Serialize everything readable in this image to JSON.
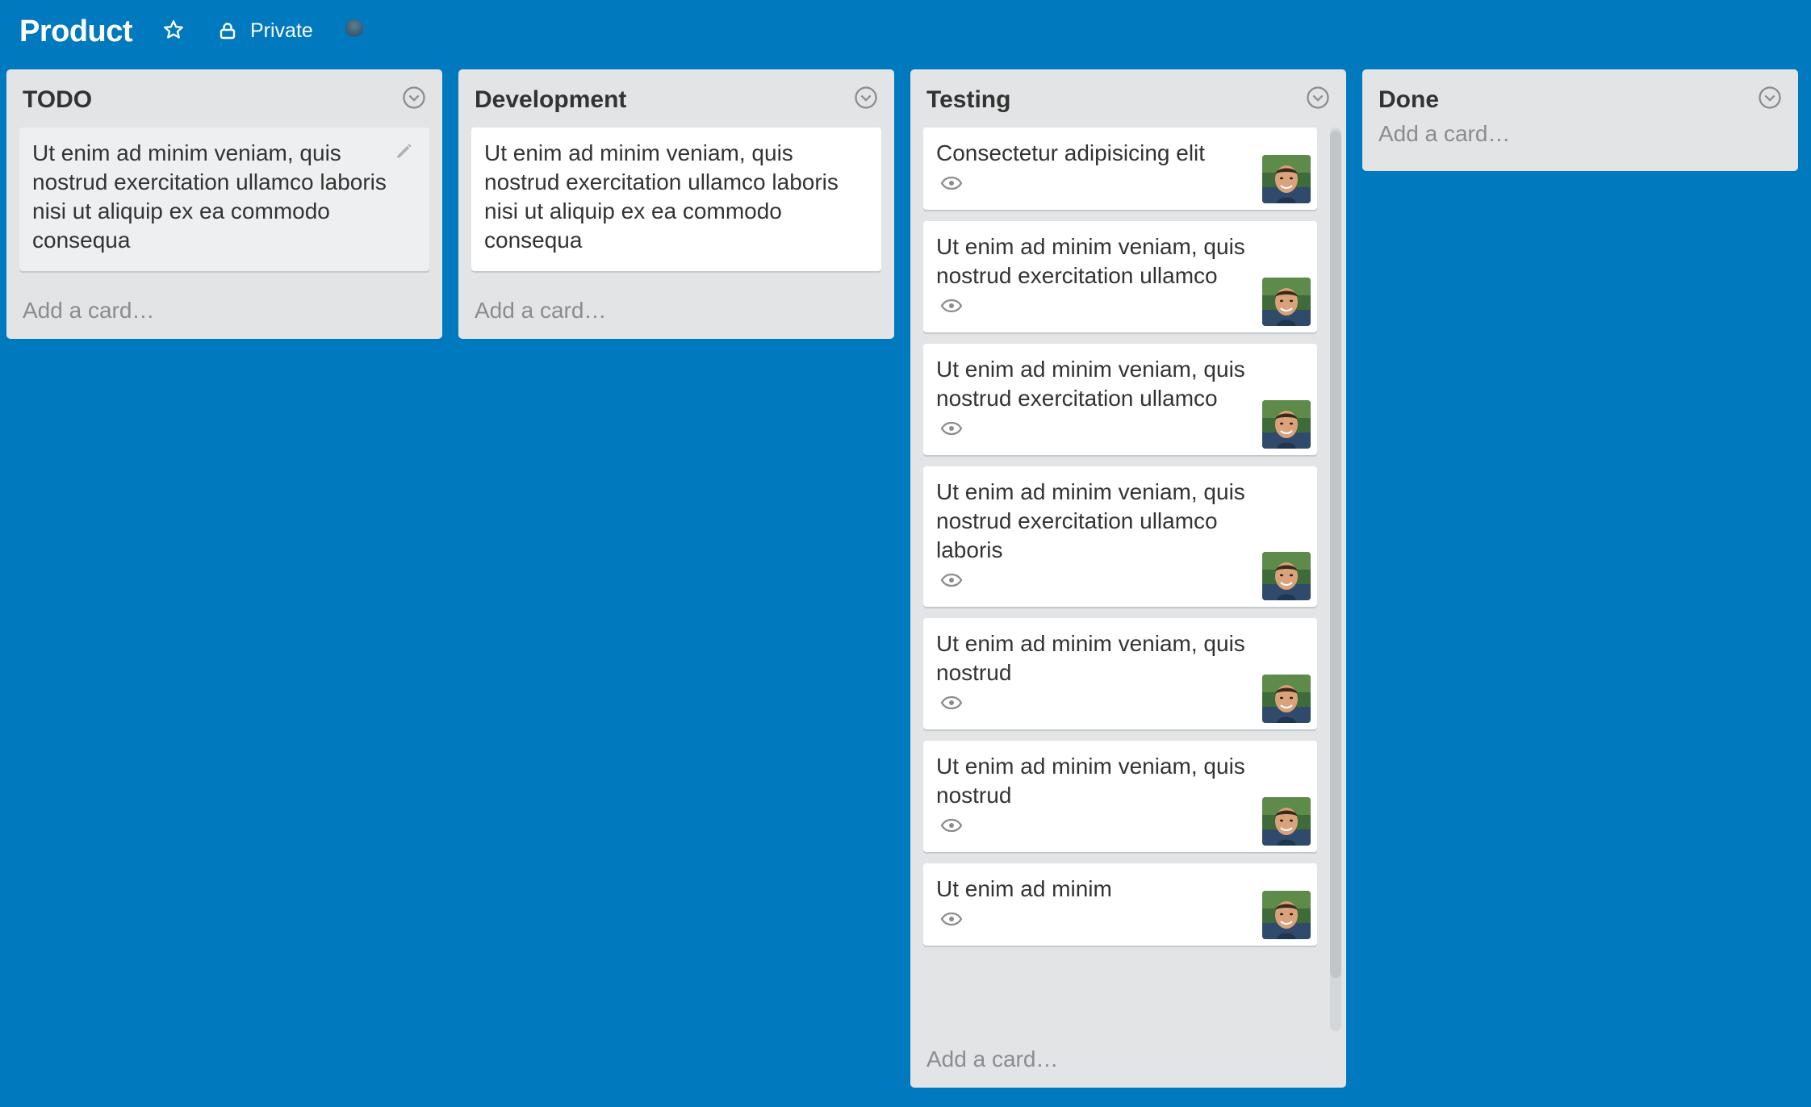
{
  "header": {
    "title": "Product",
    "privacy_label": "Private"
  },
  "lists": [
    {
      "title": "TODO",
      "cards": [
        {
          "text": "Ut enim ad minim veniam, quis nostrud exercitation ullamco laboris nisi ut aliquip ex ea commodo consequa"
        }
      ],
      "add_label": "Add a card…"
    },
    {
      "title": "Development",
      "cards": [
        {
          "text": "Ut enim ad minim veniam, quis nostrud exercitation ullamco laboris nisi ut aliquip ex ea commodo consequa"
        }
      ],
      "add_label": "Add a card…"
    },
    {
      "title": "Testing",
      "cards": [
        {
          "text": "Consectetur adipisicing elit"
        },
        {
          "text": "Ut enim ad minim veniam, quis nostrud exercitation ullamco"
        },
        {
          "text": "Ut enim ad minim veniam, quis nostrud exercitation ullamco"
        },
        {
          "text": "Ut enim ad minim veniam, quis nostrud exercitation ullamco laboris"
        },
        {
          "text": "Ut enim ad minim veniam, quis nostrud"
        },
        {
          "text": "Ut enim ad minim veniam, quis nostrud"
        },
        {
          "text": "Ut enim ad minim"
        }
      ],
      "add_label": "Add a card…"
    },
    {
      "title": "Done",
      "cards": [],
      "add_label": "Add a card…"
    }
  ],
  "colors": {
    "board_background": "#0079bf",
    "list_background": "#e2e4e6"
  },
  "icons": {
    "star": "star-icon",
    "lock": "lock-icon",
    "list_menu": "chevron-down-circle-icon",
    "edit": "pencil-icon",
    "watch": "eye-icon"
  }
}
